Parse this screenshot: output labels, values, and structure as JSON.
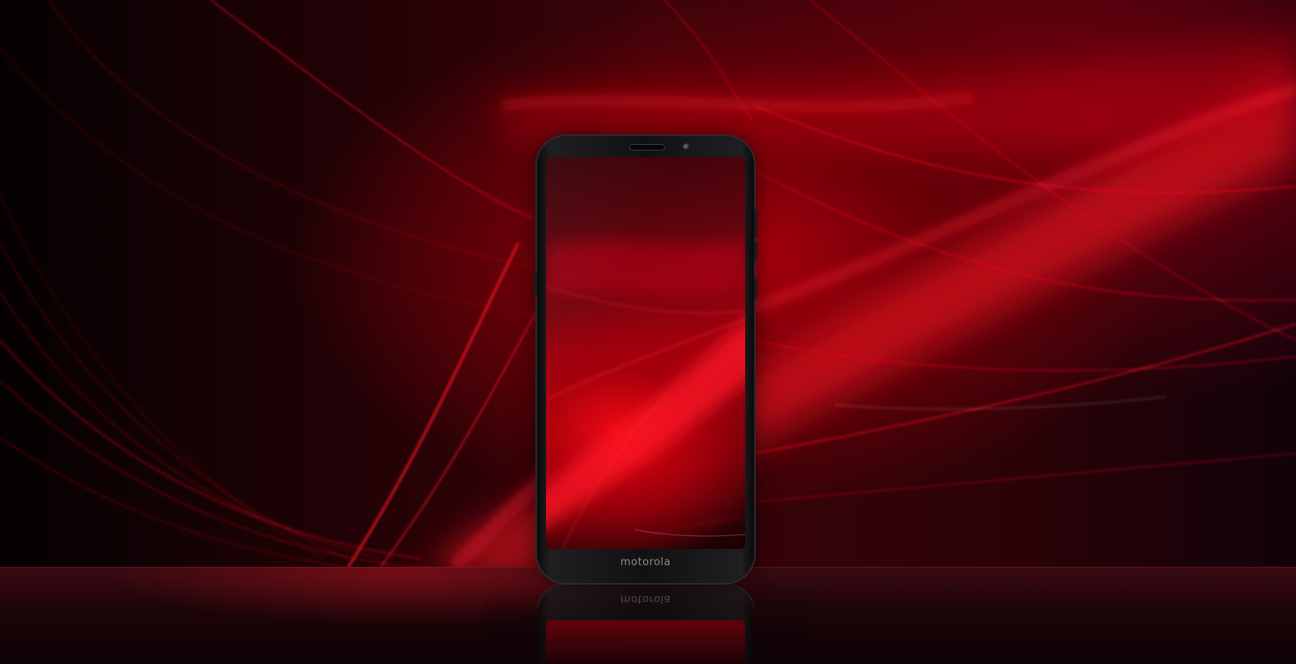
{
  "scene": {
    "background_color": "#3a0308",
    "light_color": "#e0101c",
    "floor_color": "#1e0509"
  },
  "phone": {
    "brand_logo": "motorola",
    "reflection_logo": "motorola",
    "body_color": "#111113",
    "screen_color": "#a5000d"
  }
}
